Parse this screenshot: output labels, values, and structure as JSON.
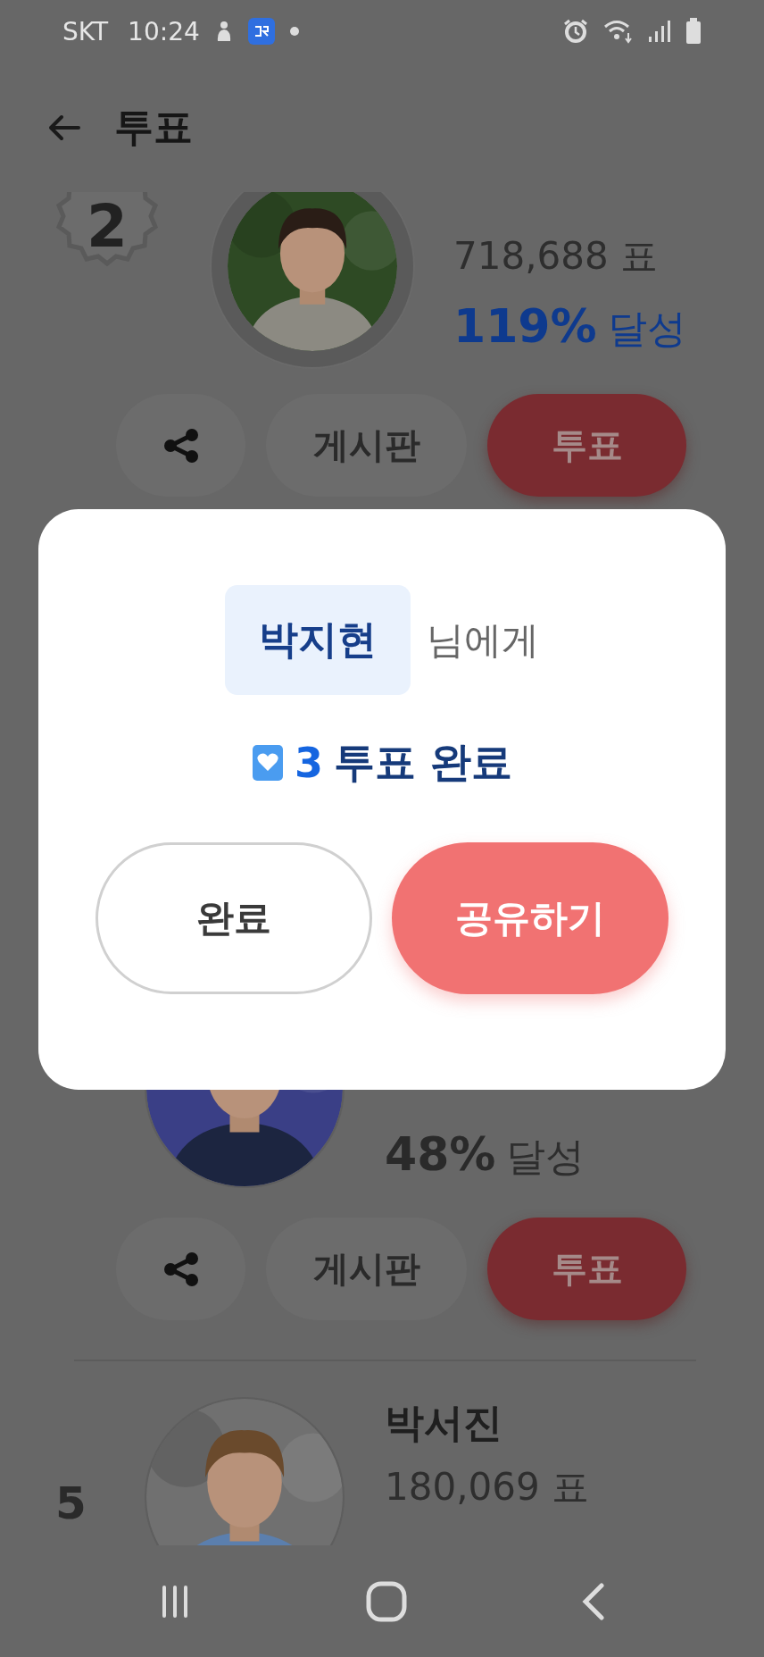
{
  "status_bar": {
    "carrier": "SKT",
    "time": "10:24"
  },
  "header": {
    "title": "투표"
  },
  "candidates": [
    {
      "kind": "medal",
      "rank": "2",
      "votes": "718,688 표",
      "percent": "119%",
      "achieved": "달성",
      "highlight": true,
      "board": "게시판",
      "vote": "투표"
    },
    {
      "kind": "partial",
      "percent": "48%",
      "achieved": "달성",
      "highlight": false,
      "board": "게시판",
      "vote": "투표"
    },
    {
      "kind": "plain",
      "rank": "5",
      "name": "박서진",
      "votes": "180,069 표"
    }
  ],
  "dialog": {
    "name": "박지현",
    "suffix": "님에게",
    "count": "3",
    "message": "투표 완료",
    "buttons": [
      {
        "label": "완료",
        "kind": "secondary"
      },
      {
        "label": "공유하기",
        "kind": "primary"
      }
    ]
  }
}
